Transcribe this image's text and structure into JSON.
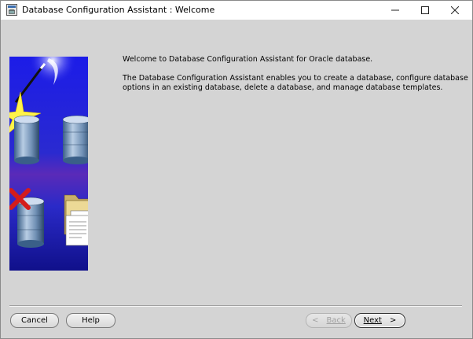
{
  "window": {
    "title": "Database Configuration Assistant : Welcome"
  },
  "content": {
    "welcome": "Welcome to Database Configuration Assistant for Oracle database.",
    "description": "The Database Configuration Assistant enables you to create a database, configure database options in an existing database, delete a database, and manage database templates."
  },
  "buttons": {
    "cancel": "Cancel",
    "help": "Help",
    "back": "Back",
    "next": "Next",
    "back_arrow": "<",
    "next_arrow": ">"
  },
  "icons": {
    "app": "oracle-app-icon",
    "minimize": "minimize-icon",
    "maximize": "maximize-icon",
    "close": "close-icon"
  },
  "colors": {
    "window_bg": "#d4d4d4",
    "illustration_bg": "#1a1ae0"
  }
}
